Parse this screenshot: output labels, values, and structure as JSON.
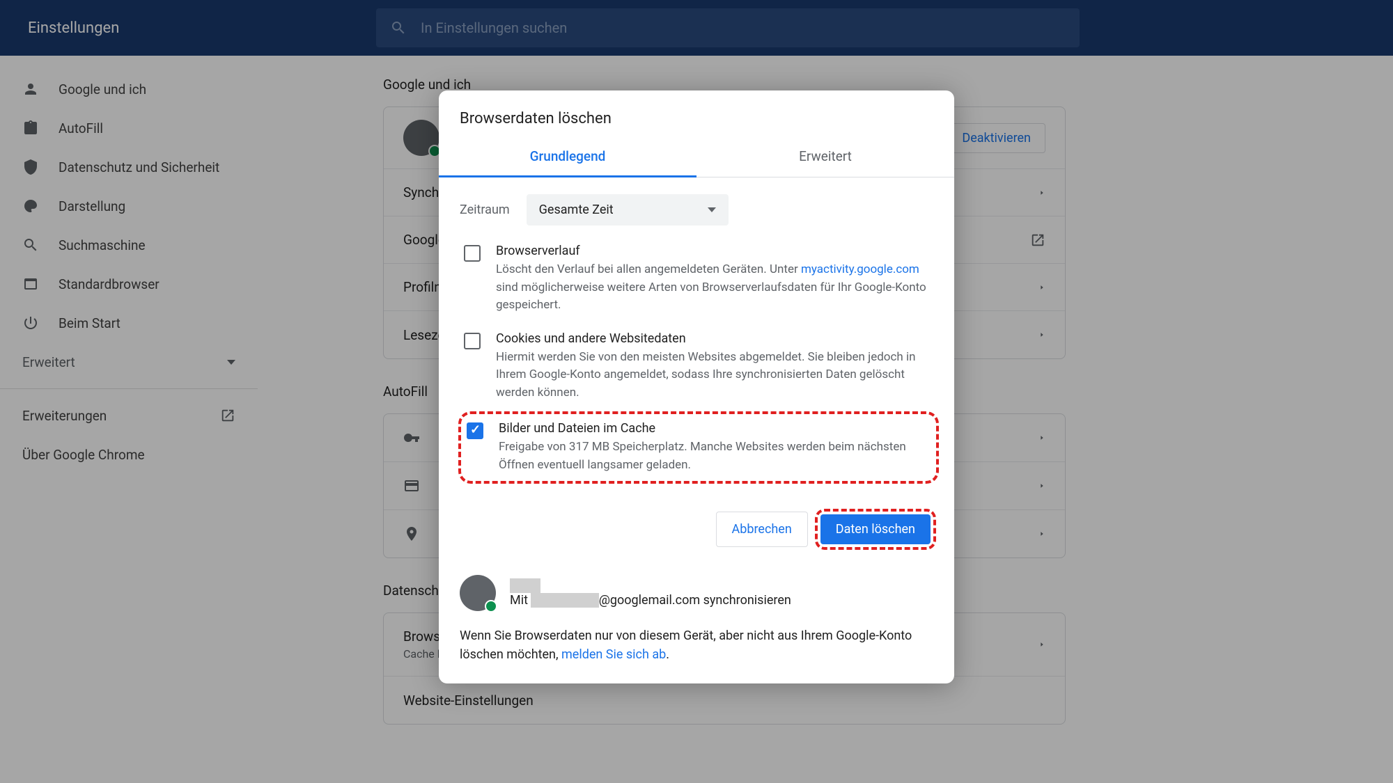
{
  "header": {
    "title": "Einstellungen",
    "search_placeholder": "In Einstellungen suchen"
  },
  "sidebar": {
    "items": [
      {
        "label": "Google und ich",
        "icon": "person"
      },
      {
        "label": "AutoFill",
        "icon": "clipboard"
      },
      {
        "label": "Datenschutz und Sicherheit",
        "icon": "shield"
      },
      {
        "label": "Darstellung",
        "icon": "palette"
      },
      {
        "label": "Suchmaschine",
        "icon": "search"
      },
      {
        "label": "Standardbrowser",
        "icon": "window"
      },
      {
        "label": "Beim Start",
        "icon": "power"
      }
    ],
    "expand": "Erweitert",
    "extensions": "Erweiterungen",
    "about": "Über Google Chrome"
  },
  "main": {
    "section1": {
      "title": "Google und ich",
      "deactivate": "Deaktivieren",
      "rows": [
        "Synchr…",
        "Google…",
        "Profilna…",
        "Leseze…"
      ]
    },
    "section2": {
      "title": "AutoFill"
    },
    "section3": {
      "title": "Datensch…",
      "row1": {
        "title": "Browse…",
        "sub": "Cache l…"
      },
      "row2": {
        "title": "Website-Einstellungen"
      }
    }
  },
  "dialog": {
    "title": "Browserdaten löschen",
    "tabs": {
      "basic": "Grundlegend",
      "advanced": "Erweitert"
    },
    "time_label": "Zeitraum",
    "time_value": "Gesamte Zeit",
    "items": [
      {
        "title": "Browserverlauf",
        "desc_pre": "Löscht den Verlauf bei allen angemeldeten Geräten. Unter ",
        "link": "myactivity.google.com",
        "desc_post": " sind möglicherweise weitere Arten von Browserverlaufsdaten für Ihr Google-Konto gespeichert.",
        "checked": false
      },
      {
        "title": "Cookies und andere Websitedaten",
        "desc": "Hiermit werden Sie von den meisten Websites abgemeldet. Sie bleiben jedoch in Ihrem Google-Konto angemeldet, sodass Ihre synchronisierten Daten gelöscht werden können.",
        "checked": false
      },
      {
        "title": "Bilder und Dateien im Cache",
        "desc": "Freigabe von 317 MB Speicherplatz. Manche Websites werden beim nächsten Öffnen eventuell langsamer geladen.",
        "checked": true
      }
    ],
    "cancel": "Abbrechen",
    "confirm": "Daten löschen",
    "account_sync_pre": "Mit ",
    "account_email_suffix": "@googlemail.com synchronisieren",
    "footer_pre": "Wenn Sie Browserdaten nur von diesem Gerät, aber nicht aus Ihrem Google-Konto löschen möchten, ",
    "footer_link": "melden Sie sich ab"
  }
}
